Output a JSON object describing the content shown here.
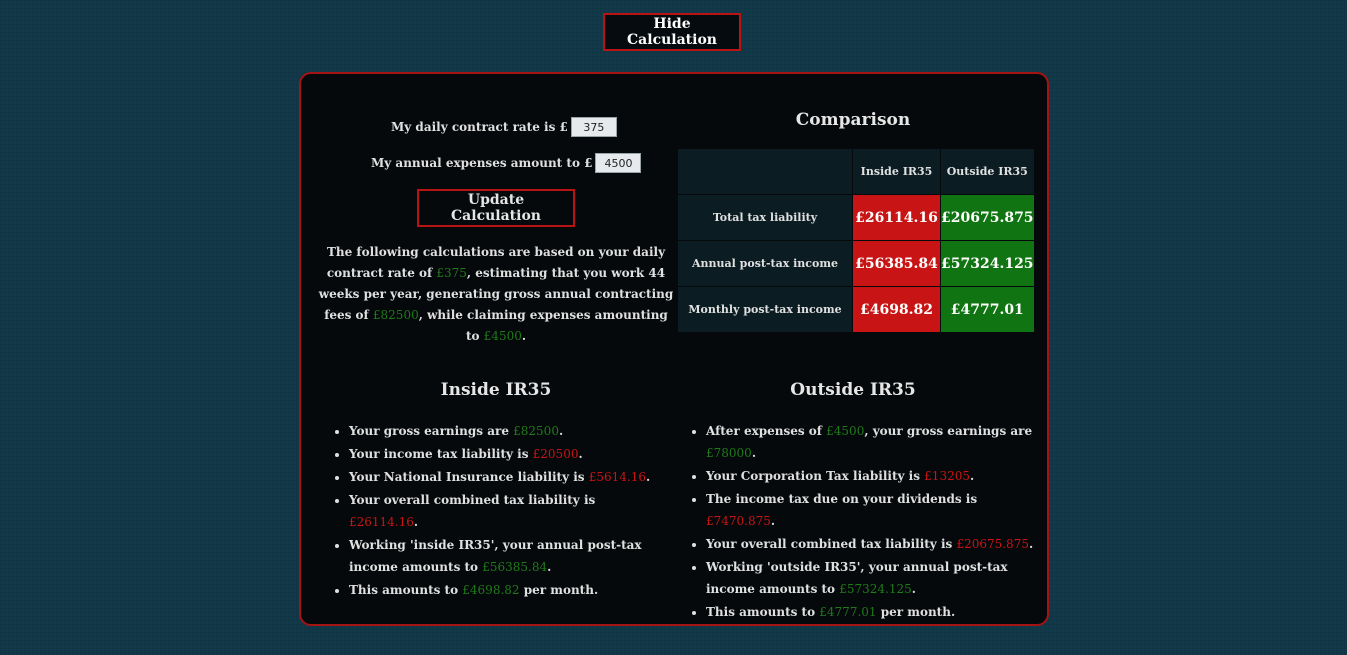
{
  "toggle_label": "Hide Calculation",
  "form": {
    "rate_prefix": "My daily contract rate is £",
    "rate_value": "375",
    "expenses_prefix": "My annual expenses amount to £",
    "expenses_value": "4500",
    "update_label": "Update Calculation"
  },
  "summary": {
    "t1": "The following calculations are based on your daily contract rate of ",
    "rate": "£375",
    "t2": ", estimating that you work 44 weeks per year, generating gross annual contracting fees of ",
    "gross": "£82500",
    "t3": ", while claiming expenses amounting to ",
    "expenses": "£4500",
    "t4": "."
  },
  "comparison": {
    "title": "Comparison",
    "headers": [
      "",
      "Inside IR35",
      "Outside IR35"
    ],
    "rows": [
      {
        "label": "Total tax liability",
        "inside": "£26114.16",
        "outside": "£20675.875"
      },
      {
        "label": "Annual post-tax income",
        "inside": "£56385.84",
        "outside": "£57324.125"
      },
      {
        "label": "Monthly post-tax income",
        "inside": "£4698.82",
        "outside": "£4777.01"
      }
    ]
  },
  "colors": {
    "positive": "#1f7a1a",
    "negative": "#c81414",
    "border_accent": "#b81414"
  },
  "inside": {
    "title": "Inside IR35",
    "items": [
      {
        "a": "Your gross earnings are ",
        "v": "£82500",
        "b": "."
      },
      {
        "a": "Your income tax liability is ",
        "v": "£20500",
        "b": "."
      },
      {
        "a": "Your National Insurance liability is ",
        "v": "£5614.16",
        "b": "."
      },
      {
        "a": "Your overall combined tax liability is ",
        "v": "£26114.16",
        "b": "."
      },
      {
        "a": "Working 'inside IR35', your annual post-tax income amounts to ",
        "v": "£56385.84",
        "b": "."
      },
      {
        "a": "This amounts to ",
        "v": "£4698.82",
        "b": " per month."
      }
    ]
  },
  "outside": {
    "title": "Outside IR35",
    "items": [
      {
        "a": "After expenses of ",
        "v1": "£4500",
        "m": ", your gross earnings are ",
        "v": "£78000",
        "b": "."
      },
      {
        "a": "Your Corporation Tax liability is ",
        "v": "£13205",
        "b": "."
      },
      {
        "a": "The income tax due on your dividends is ",
        "v": "£7470.875",
        "b": "."
      },
      {
        "a": "Your overall combined tax liability is ",
        "v": "£20675.875",
        "b": "."
      },
      {
        "a": "Working 'outside IR35', your annual post-tax income amounts to ",
        "v": "£57324.125",
        "b": "."
      },
      {
        "a": "This amounts to ",
        "v": "£4777.01",
        "b": " per month."
      }
    ]
  }
}
